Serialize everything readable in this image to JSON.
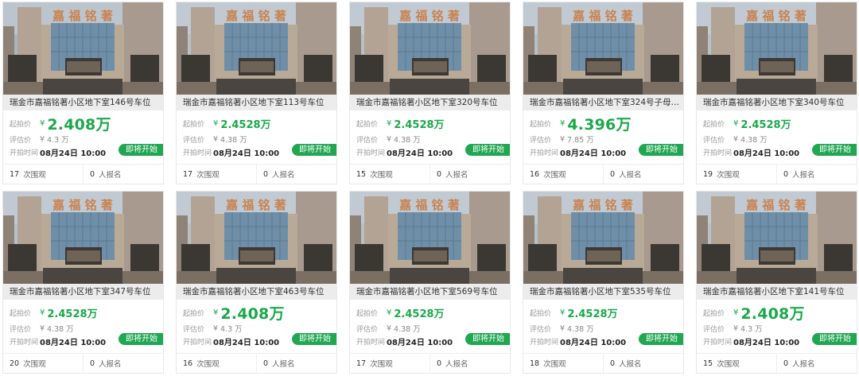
{
  "labels": {
    "start_price": "起拍价",
    "eval_price": "评估价",
    "start_time": "开拍时间",
    "badge": "即将开始",
    "yen": "¥",
    "views_suffix": "次围观",
    "signup_suffix": "人报名",
    "sign_text": "嘉 福 铭 著"
  },
  "colors": {
    "accent_green": "#21a652",
    "price_green": "#1aa84a"
  },
  "cards": [
    {
      "title": "瑞金市嘉福铭著小区地下室146号车位",
      "price": "2.408万",
      "price_size": "big",
      "eval": "4.3 万",
      "time": "08月24日 10:00",
      "views": "17",
      "signups": "0"
    },
    {
      "title": "瑞金市嘉福铭著小区地下室113号车位",
      "price": "2.4528万",
      "price_size": "mid",
      "eval": "4.38 万",
      "time": "08月24日 10:00",
      "views": "17",
      "signups": "0"
    },
    {
      "title": "瑞金市嘉福铭著小区地下室320号车位",
      "price": "2.4528万",
      "price_size": "mid",
      "eval": "4.38 万",
      "time": "08月24日 10:00",
      "views": "15",
      "signups": "0"
    },
    {
      "title": "瑞金市嘉福铭著小区地下室324号子母…",
      "price": "4.396万",
      "price_size": "big",
      "eval": "7.85 万",
      "time": "08月24日 10:00",
      "views": "16",
      "signups": "0"
    },
    {
      "title": "瑞金市嘉福铭著小区地下室340号车位",
      "price": "2.4528万",
      "price_size": "mid",
      "eval": "4.38 万",
      "time": "08月24日 10:00",
      "views": "19",
      "signups": "0"
    },
    {
      "title": "瑞金市嘉福铭著小区地下室347号车位",
      "price": "2.4528万",
      "price_size": "mid",
      "eval": "4.38 万",
      "time": "08月24日 10:00",
      "views": "20",
      "signups": "0"
    },
    {
      "title": "瑞金市嘉福铭著小区地下室463号车位",
      "price": "2.408万",
      "price_size": "big",
      "eval": "4.3 万",
      "time": "08月24日 10:00",
      "views": "16",
      "signups": "0"
    },
    {
      "title": "瑞金市嘉福铭著小区地下室569号车位",
      "price": "2.4528万",
      "price_size": "mid",
      "eval": "4.38 万",
      "time": "08月24日 10:00",
      "views": "17",
      "signups": "0"
    },
    {
      "title": "瑞金市嘉福铭著小区地下室535号车位",
      "price": "2.4528万",
      "price_size": "mid",
      "eval": "4.38 万",
      "time": "08月24日 10:00",
      "views": "18",
      "signups": "0"
    },
    {
      "title": "瑞金市嘉福铭著小区地下室141号车位",
      "price": "2.408万",
      "price_size": "big",
      "eval": "4.3 万",
      "time": "08月24日 10:00",
      "views": "15",
      "signups": "0"
    }
  ]
}
